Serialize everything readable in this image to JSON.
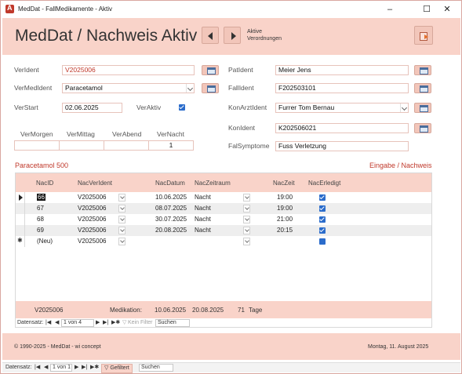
{
  "window": {
    "title": "MedDat - FallMedikamente - Aktiv"
  },
  "header": {
    "title": "MedDat / Nachweis Aktiv",
    "aktive_line1": "Aktive",
    "aktive_line2": "Verordnungen"
  },
  "fields": {
    "verident": {
      "label": "VerIdent",
      "value": "V2025006"
    },
    "vermedident": {
      "label": "VerMedIdent",
      "value": "Paracetamol"
    },
    "verstart": {
      "label": "VerStart",
      "value": "02.06.2025"
    },
    "veraktiv": {
      "label": "VerAktiv",
      "checked": true
    },
    "patident": {
      "label": "PatIdent",
      "value": "Meier Jens"
    },
    "fallident": {
      "label": "FallIdent",
      "value": "F202503101"
    },
    "konarztident": {
      "label": "KonArztIdent",
      "value": "Furrer Tom Bernau"
    },
    "konident": {
      "label": "KonIdent",
      "value": "K202506021"
    },
    "falsymptome": {
      "label": "FalSymptome",
      "value": "Fuss Verletzung"
    }
  },
  "dosage": {
    "labels": [
      "VerMorgen",
      "VerMittag",
      "VerAbend",
      "VerNacht"
    ],
    "values": [
      "",
      "",
      "",
      "1"
    ]
  },
  "section": {
    "left": "Paracetamol 500",
    "right": "Eingabe / Nachweis"
  },
  "subform": {
    "columns": [
      "NacID",
      "NacVerIdent",
      "NacDatum",
      "NacZeitraum",
      "NacZeit",
      "NacErledigt"
    ],
    "rows": [
      {
        "id": "66",
        "ver": "V2025006",
        "datum": "10.06.2025",
        "zeitraum": "Nacht",
        "zeit": "19:00",
        "erledigt": true
      },
      {
        "id": "67",
        "ver": "V2025006",
        "datum": "08.07.2025",
        "zeitraum": "Nacht",
        "zeit": "19:00",
        "erledigt": true
      },
      {
        "id": "68",
        "ver": "V2025006",
        "datum": "30.07.2025",
        "zeitraum": "Nacht",
        "zeit": "21:00",
        "erledigt": true
      },
      {
        "id": "69",
        "ver": "V2025006",
        "datum": "20.08.2025",
        "zeitraum": "Nacht",
        "zeit": "20:15",
        "erledigt": true
      }
    ],
    "newrow": {
      "id": "(Neu)",
      "ver": "V2025006"
    },
    "footer": {
      "ver": "V2025006",
      "label": "Medikation:",
      "start": "10.06.2025",
      "end": "20.08.2025",
      "days": "71",
      "unit": "Tage"
    },
    "nav": {
      "label": "Datensatz:",
      "pos": "1 von 4",
      "filter": "Kein Filter",
      "search": "Suchen"
    }
  },
  "footer": {
    "copyright": "© 1990-2025 - MedDat - wi concept",
    "date": "Montag, 11. August 2025"
  },
  "mainnav": {
    "label": "Datensatz:",
    "pos": "1 von 1",
    "filter": "Gefiltert",
    "search": "Suchen"
  }
}
